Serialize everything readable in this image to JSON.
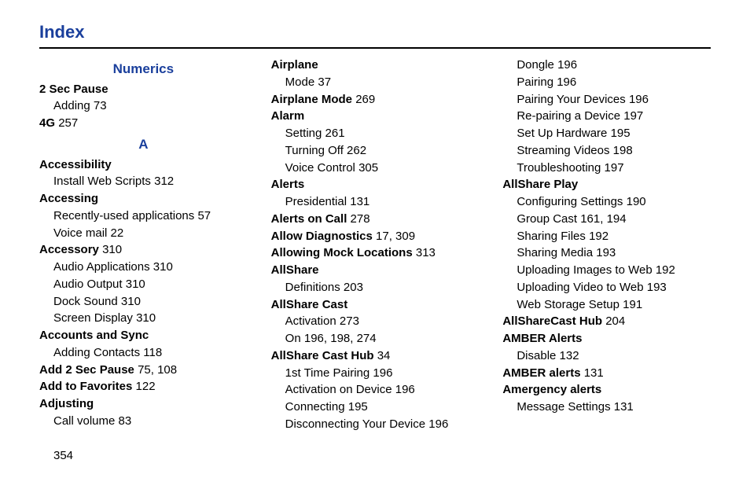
{
  "title": "Index",
  "pagenum": "354",
  "sections": {
    "numerics_head": "Numerics",
    "a_head": "A"
  },
  "col1": {
    "two_sec_pause": "2 Sec Pause",
    "two_sec_pause_adding": "Adding",
    "two_sec_pause_adding_p": "73",
    "fourg": "4G",
    "fourg_p": "257",
    "accessibility": "Accessibility",
    "accessibility_install": "Install Web Scripts",
    "accessibility_install_p": "312",
    "accessing": "Accessing",
    "accessing_recent": "Recently-used applications",
    "accessing_recent_p": "57",
    "accessing_vm": "Voice mail",
    "accessing_vm_p": "22",
    "accessory": "Accessory",
    "accessory_p": "310",
    "accessory_audio_apps": "Audio Applications",
    "accessory_audio_apps_p": "310",
    "accessory_audio_out": "Audio Output",
    "accessory_audio_out_p": "310",
    "accessory_dock": "Dock Sound",
    "accessory_dock_p": "310",
    "accessory_screen": "Screen Display",
    "accessory_screen_p": "310",
    "accounts_sync": "Accounts and Sync",
    "accounts_sync_add": "Adding Contacts",
    "accounts_sync_add_p": "118",
    "add_2sec": "Add 2 Sec Pause",
    "add_2sec_p": "75, 108",
    "add_fav": "Add to Favorites",
    "add_fav_p": "122",
    "adjusting": "Adjusting",
    "adjusting_call": "Call volume",
    "adjusting_call_p": "83"
  },
  "col2": {
    "airplane": "Airplane",
    "airplane_mode": "Mode",
    "airplane_mode_p": "37",
    "airplane_mode_term": "Airplane Mode",
    "airplane_mode_term_p": "269",
    "alarm": "Alarm",
    "alarm_setting": "Setting",
    "alarm_setting_p": "261",
    "alarm_off": "Turning Off",
    "alarm_off_p": "262",
    "alarm_voice": "Voice Control",
    "alarm_voice_p": "305",
    "alerts": "Alerts",
    "alerts_pres": "Presidential",
    "alerts_pres_p": "131",
    "alerts_on_call": "Alerts on Call",
    "alerts_on_call_p": "278",
    "allow_diag": "Allow Diagnostics",
    "allow_diag_p": "17, 309",
    "allow_mock": "Allowing Mock Locations",
    "allow_mock_p": "313",
    "allshare": "AllShare",
    "allshare_def": "Definitions",
    "allshare_def_p": "203",
    "allshare_cast": "AllShare Cast",
    "allshare_cast_act": "Activation",
    "allshare_cast_act_p": "273",
    "allshare_cast_on": "On",
    "allshare_cast_on_p": "196, 198, 274",
    "allshare_cast_hub": "AllShare Cast Hub",
    "allshare_cast_hub_p": "34",
    "hub_first": "1st Time Pairing",
    "hub_first_p": "196",
    "hub_actdev": "Activation on Device",
    "hub_actdev_p": "196",
    "hub_conn": "Connecting",
    "hub_conn_p": "195",
    "hub_disc": "Disconnecting Your Device",
    "hub_disc_p": "196"
  },
  "col3": {
    "hub_dongle": "Dongle",
    "hub_dongle_p": "196",
    "hub_pair": "Pairing",
    "hub_pair_p": "196",
    "hub_pairdev": "Pairing Your Devices",
    "hub_pairdev_p": "196",
    "hub_repair": "Re-pairing a Device",
    "hub_repair_p": "197",
    "hub_setup": "Set Up Hardware",
    "hub_setup_p": "195",
    "hub_stream": "Streaming Videos",
    "hub_stream_p": "198",
    "hub_trouble": "Troubleshooting",
    "hub_trouble_p": "197",
    "allshare_play": "AllShare Play",
    "play_conf": "Configuring Settings",
    "play_conf_p": "190",
    "play_group": "Group Cast",
    "play_group_p": "161, 194",
    "play_files": "Sharing Files",
    "play_files_p": "192",
    "play_media": "Sharing Media",
    "play_media_p": "193",
    "play_upimg": "Uploading Images to Web",
    "play_upimg_p": "192",
    "play_upvid": "Uploading Video to Web",
    "play_upvid_p": "193",
    "play_webstor": "Web Storage Setup",
    "play_webstor_p": "191",
    "allsharecast_hub2": "AllShareCast Hub",
    "allsharecast_hub2_p": "204",
    "amber_alerts": "AMBER Alerts",
    "amber_disable": "Disable",
    "amber_disable_p": "132",
    "amber_alerts2": "AMBER alerts",
    "amber_alerts2_p": "131",
    "amergency": "Amergency alerts",
    "amergency_msg": "Message Settings",
    "amergency_msg_p": "131"
  }
}
